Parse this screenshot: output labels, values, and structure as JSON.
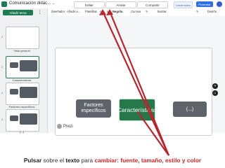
{
  "app": {
    "title": "Comunicación didác...",
    "title_chevron": "⌄"
  },
  "mode_tabs": [
    {
      "label": "Editar"
    },
    {
      "label": "Anotar"
    },
    {
      "label": "Compartir"
    }
  ],
  "header_actions": {
    "create_video": "Crear vídeo",
    "present": "Presentar"
  },
  "sidebar": {
    "add_topic": "Añadir tema",
    "menu": "⋮",
    "slides": [
      {
        "num": "1",
        "caption": "Vista general"
      },
      {
        "num": "2",
        "caption": "Características"
      },
      {
        "num": "3",
        "caption": "Factores específicos"
      },
      {
        "num": "4",
        "caption": "(...)"
      }
    ]
  },
  "toolbar": {
    "items": [
      "Diseñador",
      "Añadir a...",
      "Plantillas",
      "Negrita",
      "Cursiva",
      "Ilustrar"
    ],
    "right": "Diseño"
  },
  "canvas": {
    "topic_left": "Factores específicos",
    "topic_center": "Características",
    "topic_right": "(...)",
    "logo": "Prezi"
  },
  "caption": {
    "parts": [
      "Pulsar",
      " sobre el ",
      "texto",
      " para ",
      "cambiar: fuente, tamaño, estilo y color"
    ]
  },
  "colors": {
    "accent_green": "#1f7a52",
    "arrow_red": "#b5272d",
    "caption_red": "#c42a2a"
  }
}
